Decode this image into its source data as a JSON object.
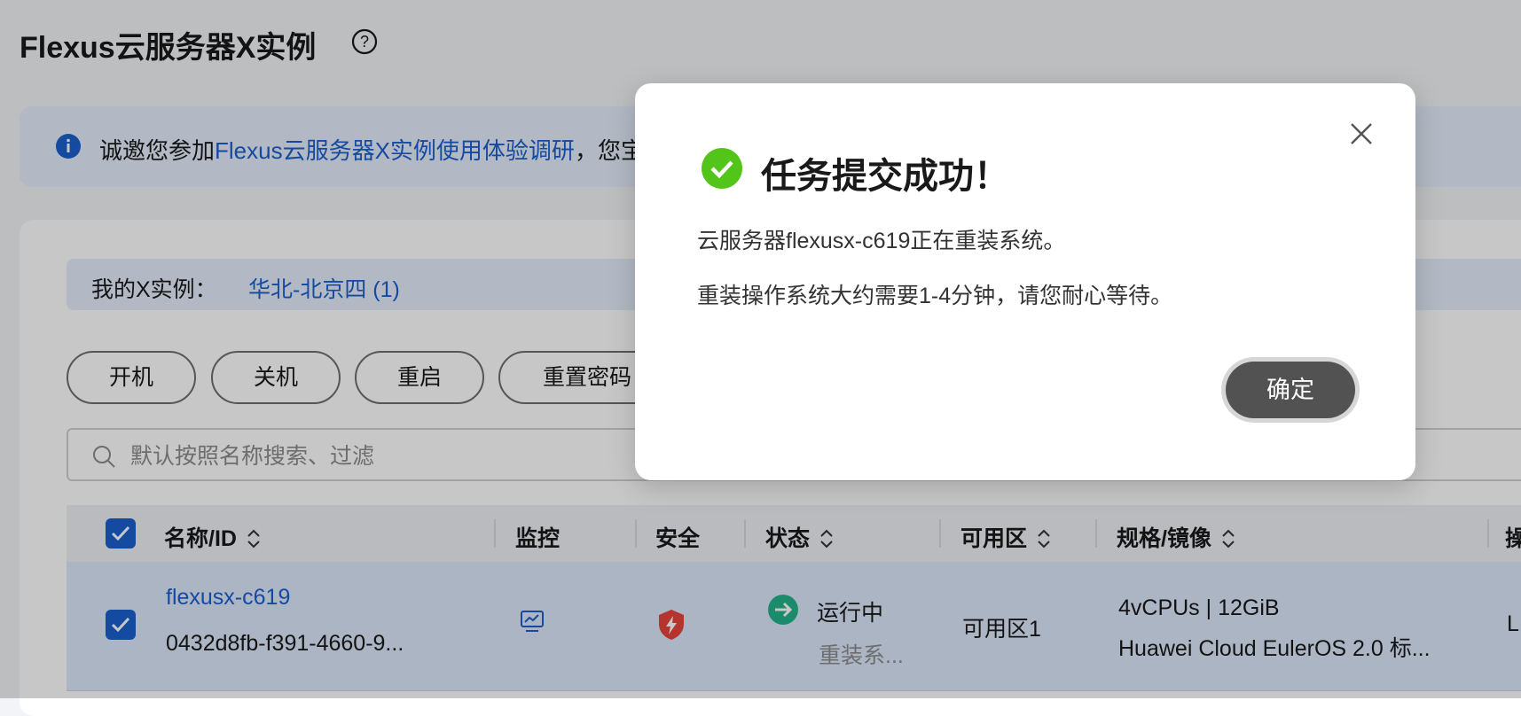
{
  "page": {
    "title": "Flexus云服务器X实例"
  },
  "banner": {
    "text_before": "诚邀您参加",
    "link_text": "Flexus云服务器X实例使用体验调研",
    "text_after": "，您宝"
  },
  "region": {
    "label": "我的X实例：",
    "value": "华北-北京四 (1)"
  },
  "toolbar": {
    "power_on": "开机",
    "power_off": "关机",
    "restart": "重启",
    "reset_password": "重置密码"
  },
  "search": {
    "placeholder": "默认按照名称搜索、过滤"
  },
  "table": {
    "columns": {
      "name_id": "名称/ID",
      "monitor": "监控",
      "security": "安全",
      "status": "状态",
      "az": "可用区",
      "spec": "规格/镜像",
      "actions": "操"
    },
    "rows": [
      {
        "name": "flexusx-c619",
        "id": "0432d8fb-f391-4660-9...",
        "status": "运行中",
        "status_sub": "重装系...",
        "az": "可用区1",
        "spec": "4vCPUs | 12GiB",
        "image": "Huawei Cloud EulerOS 2.0 标...",
        "actions": "L"
      }
    ]
  },
  "dialog": {
    "title": "任务提交成功！",
    "line1": "云服务器flexusx-c619正在重装系统。",
    "line2": "重装操作系统大约需要1-4分钟，请您耐心等待。",
    "confirm": "确定"
  },
  "colors": {
    "accent": "#1b5fcf",
    "success": "#52c41a",
    "status_running": "#24b38a",
    "security": "#e8453c",
    "confirm_button": "#525252"
  }
}
